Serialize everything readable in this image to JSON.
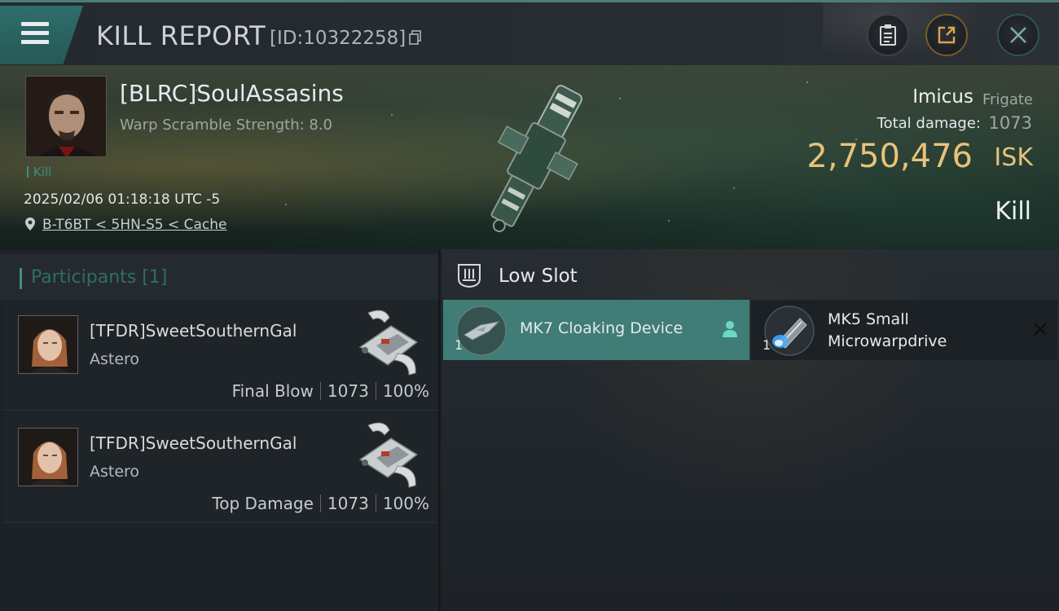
{
  "header": {
    "title": "KILL REPORT",
    "report_id": "[ID:10322258]",
    "icons": [
      "menu-icon",
      "copy-icon",
      "clipboard-icon",
      "share-icon",
      "close-icon"
    ]
  },
  "victim": {
    "pilot_name": "[BLRC]SoulAssasins",
    "subtitle": "Warp Scramble Strength: 8.0",
    "tag": "Kill",
    "datetime": "2025/02/06 01:18:18 UTC -5",
    "location": "B-T6BT < 5HN-S5 < Cache",
    "ship_name": "Imicus",
    "ship_class": "Frigate",
    "total_damage_label": "Total damage:",
    "total_damage": "1073",
    "isk_value": "2,750,476",
    "isk_unit": "ISK",
    "status": "Kill"
  },
  "participants": {
    "title": "Participants [1]",
    "rows": [
      {
        "name": "[TFDR]SweetSouthernGal",
        "ship": "Astero",
        "role": "Final Blow",
        "damage": "1073",
        "percent": "100%"
      },
      {
        "name": "[TFDR]SweetSouthernGal",
        "ship": "Astero",
        "role": "Top Damage",
        "damage": "1073",
        "percent": "100%"
      }
    ]
  },
  "modules": {
    "slot_title": "Low Slot",
    "items": [
      {
        "name": "MK7 Cloaking Device",
        "qty": "1",
        "selected": true
      },
      {
        "name_line1": "MK5 Small",
        "name_line2": "Microwarpdrive",
        "qty": "1",
        "selected": false
      }
    ]
  },
  "colors": {
    "accent": "#3e8f87",
    "isk": "#e8c27a",
    "selected_item": "#3f7d76"
  }
}
